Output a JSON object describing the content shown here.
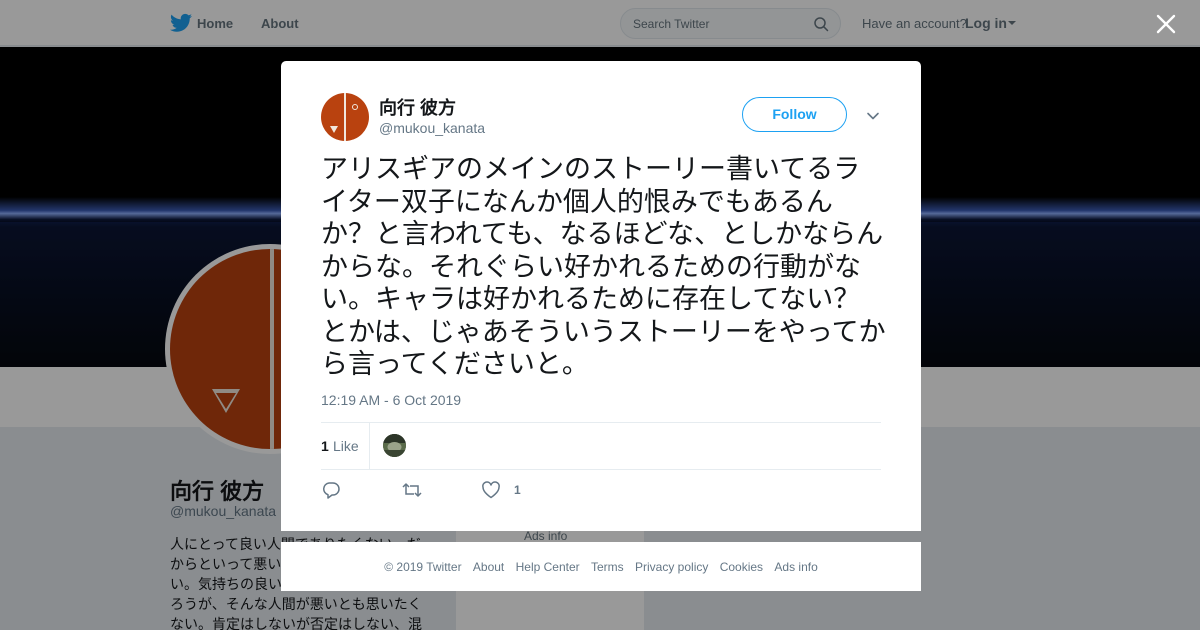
{
  "nav": {
    "home": "Home",
    "about": "About",
    "search_placeholder": "Search Twitter",
    "account_prompt": "Have an account?",
    "login": "Log in"
  },
  "profile": {
    "name": "向行 彼方",
    "handle": "@mukou_kanata",
    "bio": "人にとって良い人間でありたくない、だからといって悪い人間でありたくもない。気持ちの良い人間がいるのはいいだろうが、そんな人間が悪いとも思いたくない。肯定はしないが否定はしない、混沌",
    "ads_info": "Ads info"
  },
  "tweet": {
    "author_name": "向行 彼方",
    "author_handle": "@mukou_kanata",
    "follow_label": "Follow",
    "text": "アリスギアのメインのストーリー書いてるライター双子になんか個人的恨みでもあるんか？と言われても、なるほどな、としかならんからな。それぐらい好かれるための行動がない。キャラは好かれるために存在してない？とかは、じゃあそういうストーリーをやってから言ってくださいと。",
    "timestamp": "12:19 AM - 6 Oct 2019",
    "likes_count": "1",
    "likes_label": "Like",
    "like_action_count": "1"
  },
  "footer": {
    "copyright": "© 2019 Twitter",
    "about": "About",
    "help": "Help Center",
    "terms": "Terms",
    "privacy": "Privacy policy",
    "cookies": "Cookies",
    "ads": "Ads info"
  },
  "colors": {
    "brand": "#1da1f2",
    "avatar": "#b9420f",
    "secondary_text": "#657786"
  },
  "icons": [
    "twitter-bird-icon",
    "search-icon",
    "caret-down-icon",
    "close-icon",
    "chevron-down-icon",
    "reply-icon",
    "retweet-icon",
    "heart-icon"
  ]
}
